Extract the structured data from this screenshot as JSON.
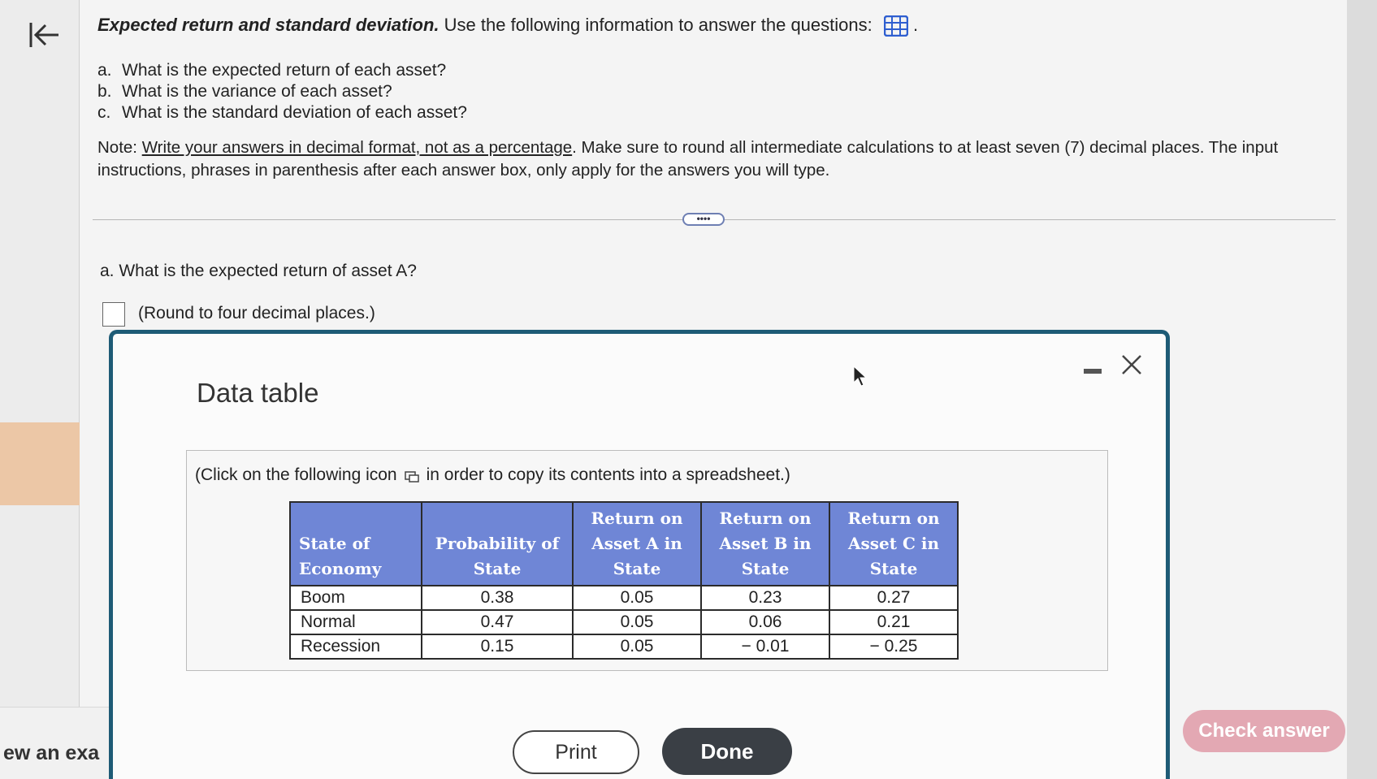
{
  "nav": {
    "back_icon": "back-arrow-icon",
    "footer_text": "ew an exa"
  },
  "question": {
    "title_bold": "Expected return and standard deviation.",
    "title_rest": "Use the following information to answer the questions:",
    "data_icon": "grid-table-icon",
    "items": [
      {
        "letter": "a.",
        "text": "What is the expected return of each asset?"
      },
      {
        "letter": "b.",
        "text": "What is the variance of each asset?"
      },
      {
        "letter": "c.",
        "text": "What is the standard deviation of each asset?"
      }
    ],
    "note_prefix": "Note:",
    "note_underlined": "Write your answers in decimal format, not as a percentage",
    "note_rest": ". Make sure to round all intermediate calculations to at least seven (7) decimal places. The input instructions, phrases in parenthesis after each answer box, only apply for the answers you will type."
  },
  "more_button": "••••",
  "part_a": {
    "question": "a.  What is the expected return of asset A?",
    "hint": "(Round to four decimal places.)"
  },
  "check_answer": "Check answer",
  "modal": {
    "title": "Data table",
    "hint_before": "(Click on the following icon",
    "hint_after": "in order to copy its contents into a spreadsheet.)",
    "table": {
      "headers": [
        "State of Economy",
        "Probability of State",
        "Return on Asset A in State",
        "Return on Asset B in State",
        "Return on Asset C in State"
      ],
      "rows": [
        [
          "Boom",
          "0.38",
          "0.05",
          "0.23",
          "0.27"
        ],
        [
          "Normal",
          "0.47",
          "0.05",
          "0.06",
          "0.21"
        ],
        [
          "Recession",
          "0.15",
          "0.05",
          "− 0.01",
          "− 0.25"
        ]
      ]
    },
    "print_label": "Print",
    "done_label": "Done"
  },
  "colors": {
    "modal_border": "#1e5b76",
    "table_header": "#6f86d6",
    "done_button": "#3a3f45",
    "check_answer": "#e3a8b3"
  }
}
